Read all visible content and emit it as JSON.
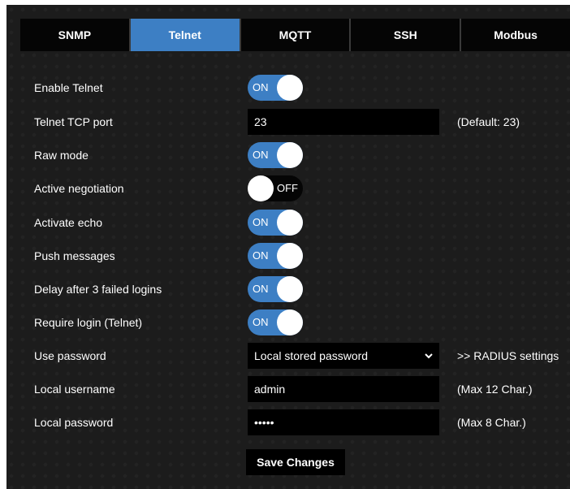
{
  "tabs": [
    {
      "label": "SNMP",
      "active": false
    },
    {
      "label": "Telnet",
      "active": true
    },
    {
      "label": "MQTT",
      "active": false
    },
    {
      "label": "SSH",
      "active": false
    },
    {
      "label": "Modbus",
      "active": false
    }
  ],
  "settings": {
    "enable_telnet": {
      "label": "Enable Telnet",
      "state": "ON"
    },
    "tcp_port": {
      "label": "Telnet TCP port",
      "value": "23",
      "hint": "(Default: 23)"
    },
    "raw_mode": {
      "label": "Raw mode",
      "state": "ON"
    },
    "active_negotiation": {
      "label": "Active negotiation",
      "state": "OFF"
    },
    "activate_echo": {
      "label": "Activate echo",
      "state": "ON"
    },
    "push_messages": {
      "label": "Push messages",
      "state": "ON"
    },
    "delay_failed_logins": {
      "label": "Delay after 3 failed logins",
      "state": "ON"
    },
    "require_login": {
      "label": "Require login (Telnet)",
      "state": "ON"
    },
    "use_password": {
      "label": "Use password",
      "selected": "Local stored password",
      "link": ">> RADIUS settings"
    },
    "local_username": {
      "label": "Local username",
      "value": "admin",
      "hint": "(Max 12 Char.)"
    },
    "local_password": {
      "label": "Local password",
      "value": "•••••",
      "hint": "(Max 8 Char.)"
    }
  },
  "save_button": {
    "label": "Save Changes"
  },
  "colors": {
    "accent": "#3d7fc4",
    "background": "#1c1c1c",
    "field": "#000000"
  },
  "icons": {
    "select_arrow": "chevron-down-icon"
  }
}
